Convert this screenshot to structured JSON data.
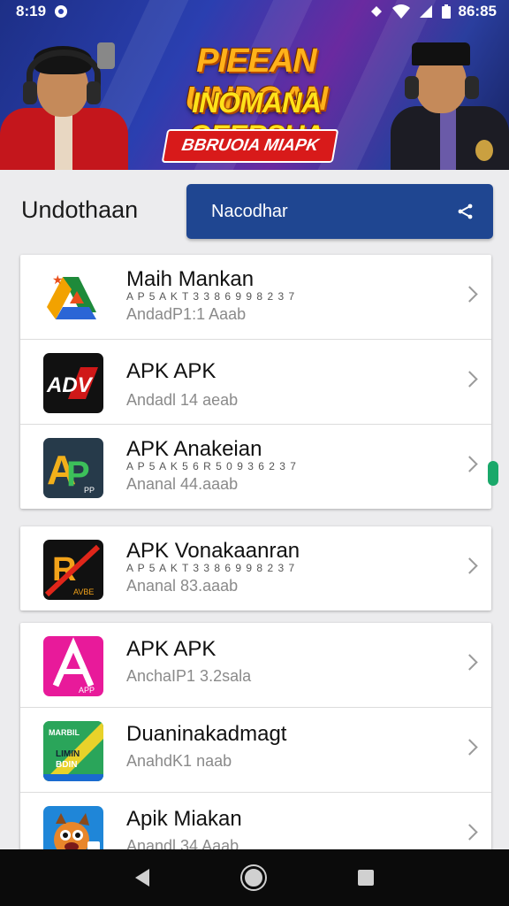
{
  "status_bar": {
    "time": "8:19",
    "battery_time": "86:85"
  },
  "banner": {
    "title_line1": "PIEEAN UNDGAN",
    "title_line2": "INOMANA GEERSUA",
    "badge": "BBRUOIA MIAPK"
  },
  "header": {
    "title": "Undothaan",
    "search_text": "Nacodhar"
  },
  "groups": [
    {
      "items": [
        {
          "title": "Maih Mankan",
          "tiny": "A P 5 A K T 3 3 8 6 9 9 8 2 3 7",
          "subtitle": "AndadP1:1 Aaab",
          "icon": "drive-like-icon"
        },
        {
          "title": "APK APK",
          "tiny": "",
          "subtitle": "Andadl 14 aeab",
          "icon": "adv-icon"
        },
        {
          "title": "APK Anakeian",
          "tiny": "A P 5 A K 5 6 R 5 0 9 3 6 2 3 7",
          "subtitle": "Ananal 44.aaab",
          "icon": "green-p-icon"
        }
      ]
    },
    {
      "items": [
        {
          "title": "APK Vonakaanran",
          "tiny": "A P 5 A K T 3 3 8 6 9 9 8 2 3 7",
          "subtitle": "Ananal 83.aaab",
          "icon": "orange-r-icon"
        }
      ]
    },
    {
      "items": [
        {
          "title": "APK APK",
          "tiny": "",
          "subtitle": "AnchaIP1 3.2sala",
          "icon": "pink-a-icon"
        },
        {
          "title": "Duaninakadmagt",
          "tiny": "",
          "subtitle": "AnahdK1 naab",
          "icon": "green-stamp-icon"
        },
        {
          "title": "Apik Miakan",
          "tiny": "",
          "subtitle": "Anandl 34 Aaab",
          "icon": "cartoon-icon"
        }
      ]
    }
  ],
  "colors": {
    "accent": "#1f4691",
    "scroll_indicator": "#1aa86a"
  }
}
